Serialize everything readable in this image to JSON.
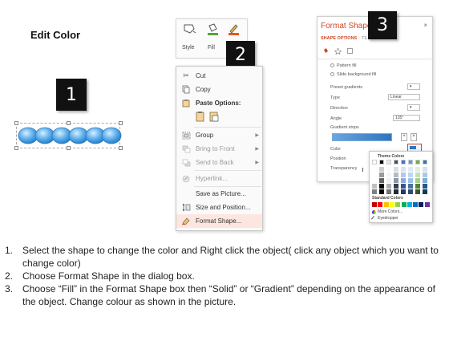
{
  "title": "Edit Color",
  "badges": [
    "1",
    "2",
    "3"
  ],
  "ribbon": {
    "items": [
      {
        "label": "Style",
        "icon": "shape-style-icon"
      },
      {
        "label": "Fill",
        "icon": "paint-bucket-icon"
      },
      {
        "label": "O",
        "icon": "pen-outline-icon"
      }
    ]
  },
  "context_menu": {
    "items": [
      {
        "label": "Cut",
        "icon": "scissors-icon",
        "enabled": true
      },
      {
        "label": "Copy",
        "icon": "copy-icon",
        "enabled": true
      },
      {
        "label": "Paste Options:",
        "icon": "paste-icon",
        "enabled": true
      },
      {
        "label": "Group",
        "icon": "group-icon",
        "enabled": true,
        "submenu": true
      },
      {
        "label": "Bring to Front",
        "icon": "bring-to-front-icon",
        "enabled": false,
        "submenu": true
      },
      {
        "label": "Send to Back",
        "icon": "send-to-back-icon",
        "enabled": false,
        "submenu": true
      },
      {
        "label": "Hyperlink...",
        "icon": "hyperlink-icon",
        "enabled": false
      },
      {
        "label": "Save as Picture...",
        "icon": "",
        "enabled": true
      },
      {
        "label": "Size and Position...",
        "icon": "size-position-icon",
        "enabled": true
      },
      {
        "label": "Format Shape...",
        "icon": "format-shape-icon",
        "enabled": true,
        "highlighted": true
      }
    ]
  },
  "format_pane": {
    "title": "Format Shape",
    "tab_active": "SHAPE OPTIONS",
    "tab_other": "TE",
    "rows": {
      "pattern_fill": "Pattern fill",
      "slide_bg_fill": "Slide background fill",
      "preset_gradients": "Preset gradients",
      "type": "Type",
      "type_value": "Linear",
      "direction": "Direction",
      "angle": "Angle",
      "angle_value": "135°",
      "gradient_stops": "Gradient stops",
      "color": "Color",
      "position": "Position",
      "transparency": "Transparency"
    }
  },
  "palette": {
    "theme_colors": "Theme Colors",
    "standard_colors": "Standard Colors",
    "more_colors": "More Colors...",
    "eyedropper": "Eyedropper",
    "theme_top": [
      "#ffffff",
      "#000000",
      "#e7e6e6",
      "#44546a",
      "#4472c4",
      "#5b9bd5",
      "#70ad47",
      "#2e75b6"
    ],
    "standard": [
      "#c00000",
      "#ff0000",
      "#ffc000",
      "#ffff00",
      "#92d050",
      "#00b050",
      "#00b0f0",
      "#0070c0",
      "#002060",
      "#7030a0"
    ],
    "accent": "#d24726"
  },
  "instructions": [
    {
      "num": "1.",
      "text": "Select the shape to change the color and Right click the object( click any object which you want to change color)"
    },
    {
      "num": "2.",
      "text": "Choose Format Shape in the dialog box."
    },
    {
      "num": "3.",
      "text": "Choose “Fill” in the Format Shape box then “Solid” or “Gradient” depending on the appearance of the object. Change colour as shown in the picture."
    }
  ]
}
